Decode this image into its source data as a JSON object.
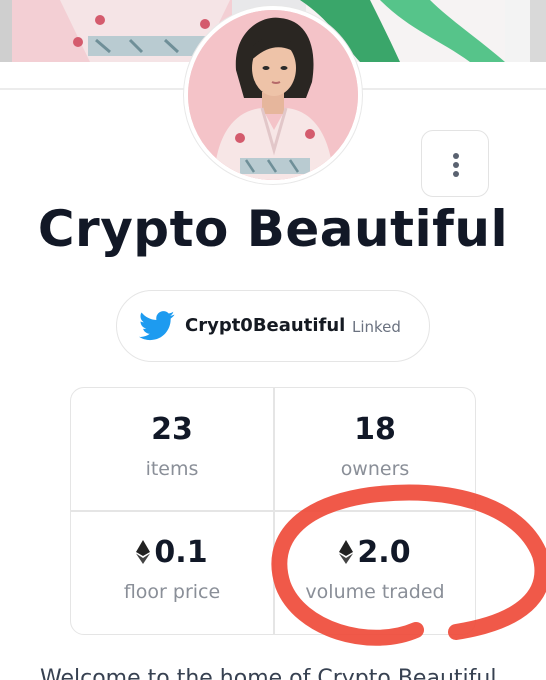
{
  "collection": {
    "title": "Crypto Beautiful",
    "more_menu_icon": "vertical-ellipsis-icon"
  },
  "twitter": {
    "icon": "twitter-bird-icon",
    "handle": "Crypt0Beautiful",
    "status": "Linked",
    "brand_color": "#1d9bf0"
  },
  "stats": [
    {
      "value": "23",
      "label": "items"
    },
    {
      "value": "18",
      "label": "owners"
    },
    {
      "value": "0.1",
      "label": "floor price",
      "currency_icon": "ethereum-icon"
    },
    {
      "value": "2.0",
      "label": "volume traded",
      "currency_icon": "ethereum-icon"
    }
  ],
  "annotation": {
    "color": "#ef4b3a"
  },
  "intro_text": "Welcome to the home of Crypto Beautiful"
}
